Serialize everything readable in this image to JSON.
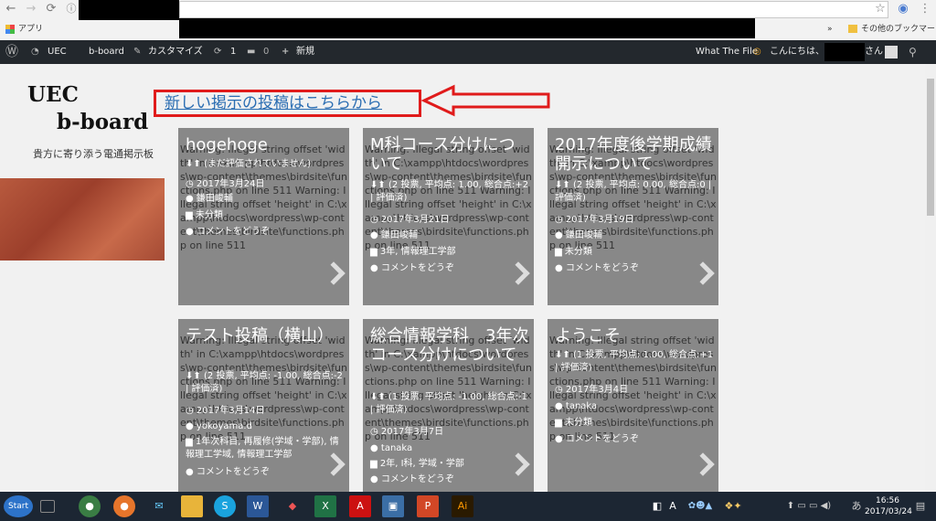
{
  "browser": {
    "bookmarks_apps": "アプリ",
    "other_bookmarks": "その他のブックマーク",
    "chevron": "»"
  },
  "admin_bar": {
    "site": "UEC",
    "board": "b-board",
    "customize": "カスタマイズ",
    "updates": "1",
    "comments": "0",
    "new": "新規",
    "what_the_file": "What The File",
    "greeting": "こんにちは、",
    "user_suffix": "さん"
  },
  "header": {
    "logo_line1": "UEC",
    "logo_line2": "b-board",
    "tagline": "貴方に寄り添う電通掲示板"
  },
  "post_link": "新しい掲示の投稿はこちらから",
  "warning_text": "Warning: Illegal string offset 'width' in C:\\xampp\\htdocs\\wordpress\\wp-content\\themes\\birdsite\\functions.php on line 511 Warning: Illegal string offset 'height' in C:\\xampp\\htdocs\\wordpress\\wp-content\\themes\\birdsite\\functions.php on line 511",
  "cards": [
    {
      "title": "hogehoge",
      "rating": "(まだ評価されていません)",
      "date": "2017年3月24日",
      "author": "鎌田峻輔",
      "category": "未分類",
      "comment": "コメントをどうぞ"
    },
    {
      "title": "M科コース分けについて",
      "rating": "(2 投票, 平均点: 1.00, 総合点:+2 | 評価済)",
      "date": "2017年3月21日",
      "author": "鎌田峻輔",
      "category": "3年, 情報理工学部",
      "comment": "コメントをどうぞ"
    },
    {
      "title": "2017年度後学期成績開示について",
      "rating": "(2 投票, 平均点: 0.00, 総合点:0 | 評価済)",
      "date": "2017年3月19日",
      "author": "鎌田峻輔",
      "category": "未分類",
      "comment": "コメントをどうぞ"
    },
    {
      "title": "テスト投稿（横山）",
      "rating": "(2 投票, 平均点: -1.00, 総合点:-2 | 評価済)",
      "date": "2017年3月14日",
      "author": "yokoyama.d",
      "category": "1年次科目, 再履修(学域・学部), 情報理工学域, 情報理工学部",
      "comment": "コメントをどうぞ"
    },
    {
      "title": "総合情報学科　3年次コース分けについて",
      "rating": "(1 投票, 平均点: -1.00, 総合点:-1 | 評価済)",
      "date": "2017年3月7日",
      "author": "tanaka",
      "category": "2年, I科, 学域・学部",
      "comment": "コメントをどうぞ"
    },
    {
      "title": "ようこそ",
      "rating": "(1 投票, 平均点: 1.00, 総合点:+1 | 評価済)",
      "date": "2017年3月4日",
      "author": "tanaka",
      "category": "未分類",
      "comment": "コメントをどうぞ"
    }
  ],
  "taskbar": {
    "start": "Start",
    "time": "16:56",
    "date": "2017/03/24"
  }
}
